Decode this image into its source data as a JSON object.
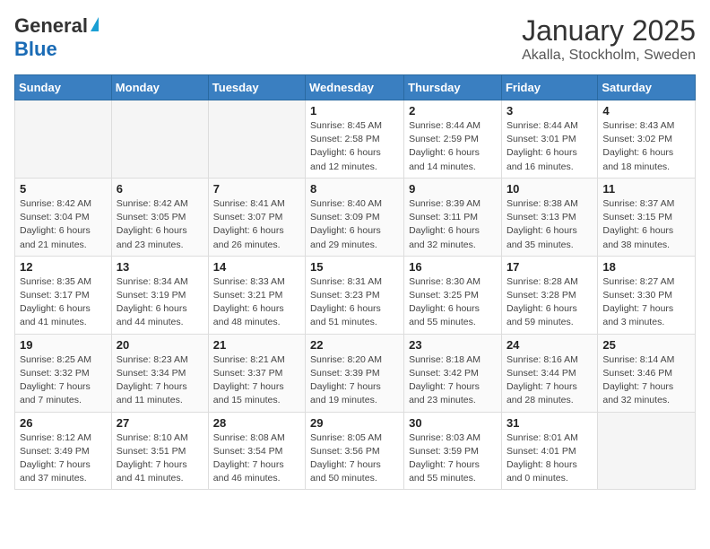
{
  "header": {
    "logo_line1": "General",
    "logo_line2": "Blue",
    "title": "January 2025",
    "subtitle": "Akalla, Stockholm, Sweden"
  },
  "calendar": {
    "days_of_week": [
      "Sunday",
      "Monday",
      "Tuesday",
      "Wednesday",
      "Thursday",
      "Friday",
      "Saturday"
    ],
    "weeks": [
      [
        {
          "day": "",
          "sunrise": "",
          "sunset": "",
          "daylight": ""
        },
        {
          "day": "",
          "sunrise": "",
          "sunset": "",
          "daylight": ""
        },
        {
          "day": "",
          "sunrise": "",
          "sunset": "",
          "daylight": ""
        },
        {
          "day": "1",
          "sunrise": "Sunrise: 8:45 AM",
          "sunset": "Sunset: 2:58 PM",
          "daylight": "Daylight: 6 hours and 12 minutes."
        },
        {
          "day": "2",
          "sunrise": "Sunrise: 8:44 AM",
          "sunset": "Sunset: 2:59 PM",
          "daylight": "Daylight: 6 hours and 14 minutes."
        },
        {
          "day": "3",
          "sunrise": "Sunrise: 8:44 AM",
          "sunset": "Sunset: 3:01 PM",
          "daylight": "Daylight: 6 hours and 16 minutes."
        },
        {
          "day": "4",
          "sunrise": "Sunrise: 8:43 AM",
          "sunset": "Sunset: 3:02 PM",
          "daylight": "Daylight: 6 hours and 18 minutes."
        }
      ],
      [
        {
          "day": "5",
          "sunrise": "Sunrise: 8:42 AM",
          "sunset": "Sunset: 3:04 PM",
          "daylight": "Daylight: 6 hours and 21 minutes."
        },
        {
          "day": "6",
          "sunrise": "Sunrise: 8:42 AM",
          "sunset": "Sunset: 3:05 PM",
          "daylight": "Daylight: 6 hours and 23 minutes."
        },
        {
          "day": "7",
          "sunrise": "Sunrise: 8:41 AM",
          "sunset": "Sunset: 3:07 PM",
          "daylight": "Daylight: 6 hours and 26 minutes."
        },
        {
          "day": "8",
          "sunrise": "Sunrise: 8:40 AM",
          "sunset": "Sunset: 3:09 PM",
          "daylight": "Daylight: 6 hours and 29 minutes."
        },
        {
          "day": "9",
          "sunrise": "Sunrise: 8:39 AM",
          "sunset": "Sunset: 3:11 PM",
          "daylight": "Daylight: 6 hours and 32 minutes."
        },
        {
          "day": "10",
          "sunrise": "Sunrise: 8:38 AM",
          "sunset": "Sunset: 3:13 PM",
          "daylight": "Daylight: 6 hours and 35 minutes."
        },
        {
          "day": "11",
          "sunrise": "Sunrise: 8:37 AM",
          "sunset": "Sunset: 3:15 PM",
          "daylight": "Daylight: 6 hours and 38 minutes."
        }
      ],
      [
        {
          "day": "12",
          "sunrise": "Sunrise: 8:35 AM",
          "sunset": "Sunset: 3:17 PM",
          "daylight": "Daylight: 6 hours and 41 minutes."
        },
        {
          "day": "13",
          "sunrise": "Sunrise: 8:34 AM",
          "sunset": "Sunset: 3:19 PM",
          "daylight": "Daylight: 6 hours and 44 minutes."
        },
        {
          "day": "14",
          "sunrise": "Sunrise: 8:33 AM",
          "sunset": "Sunset: 3:21 PM",
          "daylight": "Daylight: 6 hours and 48 minutes."
        },
        {
          "day": "15",
          "sunrise": "Sunrise: 8:31 AM",
          "sunset": "Sunset: 3:23 PM",
          "daylight": "Daylight: 6 hours and 51 minutes."
        },
        {
          "day": "16",
          "sunrise": "Sunrise: 8:30 AM",
          "sunset": "Sunset: 3:25 PM",
          "daylight": "Daylight: 6 hours and 55 minutes."
        },
        {
          "day": "17",
          "sunrise": "Sunrise: 8:28 AM",
          "sunset": "Sunset: 3:28 PM",
          "daylight": "Daylight: 6 hours and 59 minutes."
        },
        {
          "day": "18",
          "sunrise": "Sunrise: 8:27 AM",
          "sunset": "Sunset: 3:30 PM",
          "daylight": "Daylight: 7 hours and 3 minutes."
        }
      ],
      [
        {
          "day": "19",
          "sunrise": "Sunrise: 8:25 AM",
          "sunset": "Sunset: 3:32 PM",
          "daylight": "Daylight: 7 hours and 7 minutes."
        },
        {
          "day": "20",
          "sunrise": "Sunrise: 8:23 AM",
          "sunset": "Sunset: 3:34 PM",
          "daylight": "Daylight: 7 hours and 11 minutes."
        },
        {
          "day": "21",
          "sunrise": "Sunrise: 8:21 AM",
          "sunset": "Sunset: 3:37 PM",
          "daylight": "Daylight: 7 hours and 15 minutes."
        },
        {
          "day": "22",
          "sunrise": "Sunrise: 8:20 AM",
          "sunset": "Sunset: 3:39 PM",
          "daylight": "Daylight: 7 hours and 19 minutes."
        },
        {
          "day": "23",
          "sunrise": "Sunrise: 8:18 AM",
          "sunset": "Sunset: 3:42 PM",
          "daylight": "Daylight: 7 hours and 23 minutes."
        },
        {
          "day": "24",
          "sunrise": "Sunrise: 8:16 AM",
          "sunset": "Sunset: 3:44 PM",
          "daylight": "Daylight: 7 hours and 28 minutes."
        },
        {
          "day": "25",
          "sunrise": "Sunrise: 8:14 AM",
          "sunset": "Sunset: 3:46 PM",
          "daylight": "Daylight: 7 hours and 32 minutes."
        }
      ],
      [
        {
          "day": "26",
          "sunrise": "Sunrise: 8:12 AM",
          "sunset": "Sunset: 3:49 PM",
          "daylight": "Daylight: 7 hours and 37 minutes."
        },
        {
          "day": "27",
          "sunrise": "Sunrise: 8:10 AM",
          "sunset": "Sunset: 3:51 PM",
          "daylight": "Daylight: 7 hours and 41 minutes."
        },
        {
          "day": "28",
          "sunrise": "Sunrise: 8:08 AM",
          "sunset": "Sunset: 3:54 PM",
          "daylight": "Daylight: 7 hours and 46 minutes."
        },
        {
          "day": "29",
          "sunrise": "Sunrise: 8:05 AM",
          "sunset": "Sunset: 3:56 PM",
          "daylight": "Daylight: 7 hours and 50 minutes."
        },
        {
          "day": "30",
          "sunrise": "Sunrise: 8:03 AM",
          "sunset": "Sunset: 3:59 PM",
          "daylight": "Daylight: 7 hours and 55 minutes."
        },
        {
          "day": "31",
          "sunrise": "Sunrise: 8:01 AM",
          "sunset": "Sunset: 4:01 PM",
          "daylight": "Daylight: 8 hours and 0 minutes."
        },
        {
          "day": "",
          "sunrise": "",
          "sunset": "",
          "daylight": ""
        }
      ]
    ]
  }
}
